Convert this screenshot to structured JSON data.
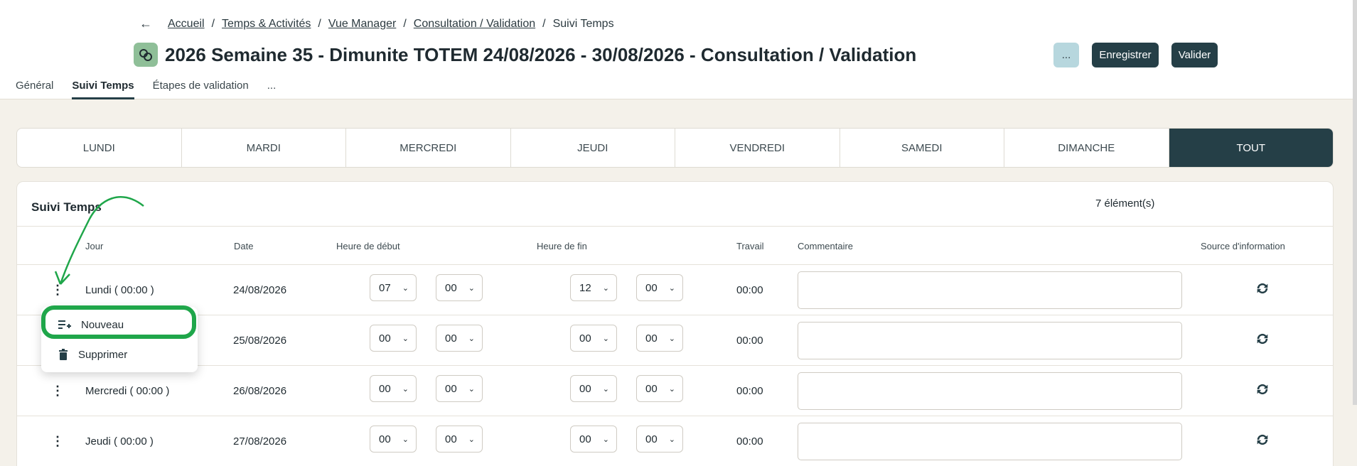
{
  "breadcrumb": {
    "back_icon": "arrow-left-icon",
    "items": [
      "Accueil",
      "Temps & Activités",
      "Vue Manager",
      "Consultation / Validation",
      "Suivi Temps"
    ]
  },
  "header": {
    "title": "2026 Semaine 35 - Dimunite TOTEM 24/08/2026 - 30/08/2026 - Consultation / Validation",
    "more_label": "...",
    "save_label": "Enregistrer",
    "validate_label": "Valider"
  },
  "tabs": [
    "Général",
    "Suivi Temps",
    "Étapes de validation",
    "..."
  ],
  "days": [
    "LUNDI",
    "MARDI",
    "MERCREDI",
    "JEUDI",
    "VENDREDI",
    "SAMEDI",
    "DIMANCHE",
    "TOUT"
  ],
  "panel": {
    "title": "Suivi Temps",
    "count": "7 élément(s)",
    "columns": [
      "Jour",
      "Date",
      "Heure de début",
      "Heure de fin",
      "Travail",
      "Commentaire",
      "Source d'information"
    ]
  },
  "rows": [
    {
      "jour": "Lundi ( 00:00 )",
      "date": "24/08/2026",
      "start_h": "07",
      "start_m": "00",
      "end_h": "12",
      "end_m": "00",
      "work": "00:00"
    },
    {
      "jour": "",
      "date": "25/08/2026",
      "start_h": "00",
      "start_m": "00",
      "end_h": "00",
      "end_m": "00",
      "work": "00:00"
    },
    {
      "jour": "Mercredi ( 00:00 )",
      "date": "26/08/2026",
      "start_h": "00",
      "start_m": "00",
      "end_h": "00",
      "end_m": "00",
      "work": "00:00"
    },
    {
      "jour": "Jeudi ( 00:00 )",
      "date": "27/08/2026",
      "start_h": "00",
      "start_m": "00",
      "end_h": "00",
      "end_m": "00",
      "work": "00:00"
    }
  ],
  "menu": {
    "new_label": "Nouveau",
    "delete_label": "Supprimer"
  },
  "colors": {
    "accent": "#253f47",
    "highlight": "#1fa64a",
    "background": "#f4f1ea"
  }
}
